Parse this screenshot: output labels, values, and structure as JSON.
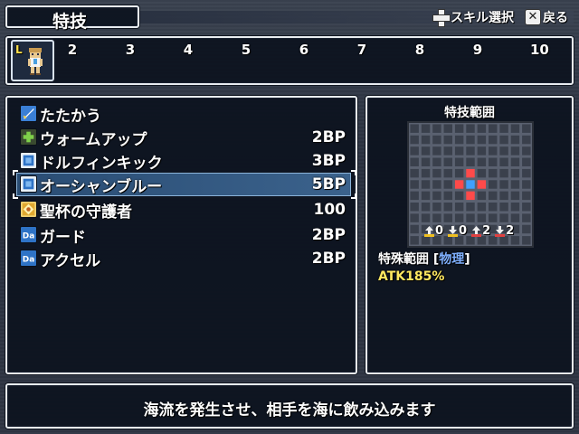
{
  "header": {
    "title": "特技"
  },
  "help": [
    {
      "icon": "dpad-icon",
      "label": "スキル選択"
    },
    {
      "icon": "cancel-button-icon",
      "glyph": "✕",
      "label": "戻る"
    }
  ],
  "party": {
    "selected_slot_marker": "L",
    "slots": [
      "2",
      "3",
      "4",
      "5",
      "6",
      "7",
      "8",
      "9",
      "10"
    ]
  },
  "skills": [
    {
      "name": "たたかう",
      "cost": "",
      "icon": "attack-icon",
      "icon_color": "#3a7fd6"
    },
    {
      "name": "ウォームアップ",
      "cost": "2BP",
      "icon": "plus-icon",
      "icon_color": "#6fbe3a"
    },
    {
      "name": "ドルフィンキック",
      "cost": "3BP",
      "icon": "physical-skill-icon",
      "icon_color": "#2e73c6"
    },
    {
      "name": "オーシャンブルー",
      "cost": "5BP",
      "icon": "physical-skill-icon",
      "icon_color": "#2e73c6",
      "selected": true
    },
    {
      "name": "聖杯の守護者",
      "cost": "100",
      "icon": "special-skill-icon",
      "icon_color": "#e0a830"
    },
    {
      "name": "ガード",
      "cost": "2BP",
      "icon": "da-icon",
      "icon_color": "#2e73c6"
    },
    {
      "name": "アクセル",
      "cost": "2BP",
      "icon": "da-icon",
      "icon_color": "#2e73c6"
    }
  ],
  "range": {
    "title": "特技範囲",
    "grid_cells": 11,
    "targets": [
      [
        5,
        4
      ],
      [
        4,
        5
      ],
      [
        6,
        5
      ],
      [
        5,
        6
      ]
    ],
    "center_color": "#3fa0ff",
    "target_color": "#ff4a4a",
    "stats": [
      {
        "icon": "up-arrow-icon",
        "color": "#f0c020",
        "value": "0"
      },
      {
        "icon": "down-arrow-icon",
        "color": "#f0c020",
        "value": "0"
      },
      {
        "icon": "up-arrow-icon",
        "color": "#e04040",
        "value": "2"
      },
      {
        "icon": "down-arrow-icon",
        "color": "#e04040",
        "value": "2"
      }
    ],
    "desc_prefix": "特殊範囲 [",
    "element": "物理",
    "desc_suffix": "]",
    "atk": "ATK185%"
  },
  "description": "海流を発生させ、相手を海に飲み込みます"
}
